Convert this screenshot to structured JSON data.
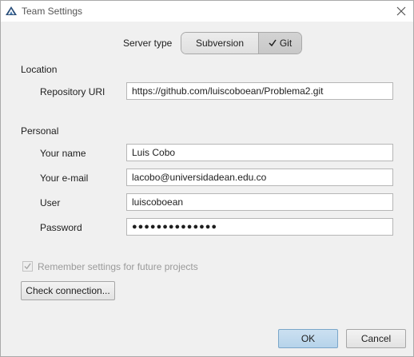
{
  "window": {
    "title": "Team Settings"
  },
  "server_type": {
    "label": "Server type",
    "options": [
      "Subversion",
      "Git"
    ],
    "selected": "Git"
  },
  "location": {
    "section_label": "Location",
    "repo_uri_label": "Repository URI",
    "repo_uri_value": "https://github.com/luiscoboean/Problema2.git"
  },
  "personal": {
    "section_label": "Personal",
    "name_label": "Your name",
    "name_value": "Luis Cobo",
    "email_label": "Your e-mail",
    "email_value": "lacobo@universidadean.edu.co",
    "user_label": "User",
    "user_value": "luiscoboean",
    "password_label": "Password",
    "password_mask": "●●●●●●●●●●●●●●"
  },
  "remember": {
    "label": "Remember settings for future projects",
    "checked": true,
    "enabled": false
  },
  "buttons": {
    "check_connection": "Check connection...",
    "ok": "OK",
    "cancel": "Cancel"
  },
  "icons": {
    "app": "app-logo-icon",
    "close": "close-icon",
    "check": "checkmark-icon"
  },
  "colors": {
    "primary_button": "#b6d3ea",
    "disabled_text": "#9a9a9a"
  }
}
